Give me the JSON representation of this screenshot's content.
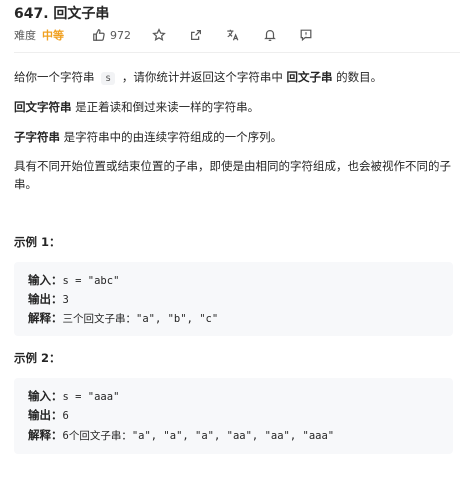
{
  "problem": {
    "title": "647. 回文子串",
    "difficulty_label": "难度",
    "difficulty_value": "中等",
    "likes": "972"
  },
  "toolbar": {
    "icons": [
      "thumbs-up-icon",
      "star-icon",
      "share-icon",
      "translate-icon",
      "bell-icon",
      "feedback-icon"
    ]
  },
  "description": {
    "p1_a": "给你一个字符串 ",
    "p1_code": "s",
    "p1_b": " ，请你统计并返回这个字符串中 ",
    "p1_bold": "回文子串",
    "p1_c": " 的数目。",
    "p2_bold": "回文字符串",
    "p2_rest": " 是正着读和倒过来读一样的字符串。",
    "p3_bold": "子字符串",
    "p3_rest": " 是字符串中的由连续字符组成的一个序列。",
    "p4": "具有不同开始位置或结束位置的子串，即使是由相同的字符组成，也会被视作不同的子串。"
  },
  "examples": [
    {
      "title": "示例 1：",
      "input_label": "输入：",
      "input_value": "s = \"abc\"",
      "output_label": "输出：",
      "output_value": "3",
      "explain_label": "解释：",
      "explain_value": "三个回文子串：\"a\", \"b\", \"c\""
    },
    {
      "title": "示例 2：",
      "input_label": "输入：",
      "input_value": "s = \"aaa\"",
      "output_label": "输出：",
      "output_value": "6",
      "explain_label": "解释：",
      "explain_value": "6个回文子串：\"a\", \"a\", \"a\", \"aa\", \"aa\", \"aaa\""
    }
  ]
}
